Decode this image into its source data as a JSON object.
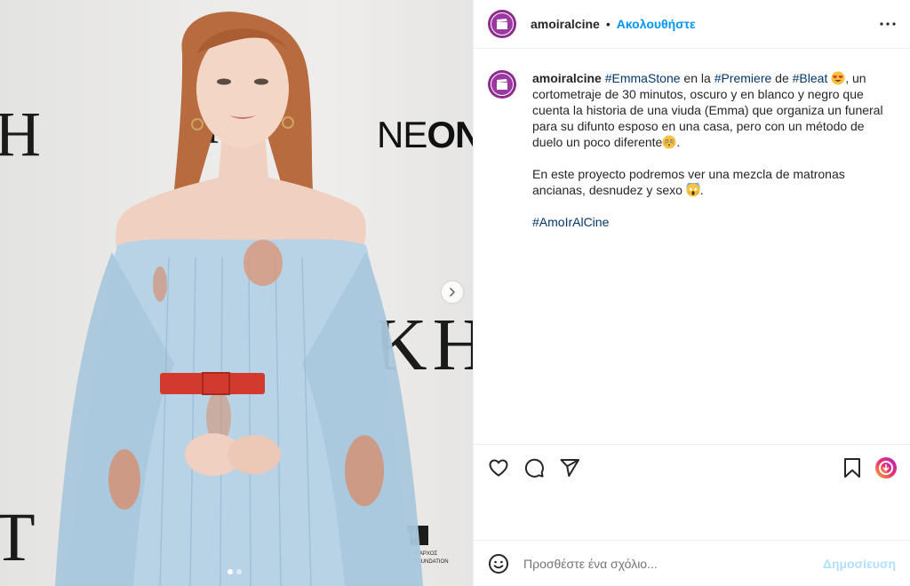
{
  "post": {
    "backdrop": {
      "neon_bold": "NE",
      "neon_rest": "ON",
      "snf_label": "N / SNF",
      "snf_caption": "Α ΣΤΑΥΡΟΣ ΝΙΑΡΧΟΣ NIARCHOS FOUNDATION",
      "letters_left": "H",
      "letters_right": "KH",
      "letters_bottom": "T"
    },
    "carousel": {
      "dot_count": 2,
      "active_index": 0
    }
  },
  "header": {
    "username": "amoiralcine",
    "separator": "•",
    "follow_label": "Ακολουθήστε"
  },
  "caption": {
    "username": "amoiralcine",
    "tag_emma": "#EmmaStone",
    "text_en_la": " en la ",
    "tag_premiere": "#Premiere",
    "text_de": " de ",
    "tag_bleat": "#Bleat",
    "text_main": ", un cortometraje de 30 minutos, oscuro y en blanco y negro que cuenta la historia de una viuda (Emma) que organiza un funeral para su difunto esposo en una casa, pero con un método de duelo un poco diferente",
    "para2": "En este proyecto podremos ver una mezcla de matronas ancianas, desnudez y sexo ",
    "para2_end": ".",
    "tag_amoir": "#AmoIrAlCine"
  },
  "actions": {
    "like": "heart-icon",
    "comment": "comment-icon",
    "share": "share-icon",
    "save": "bookmark-icon",
    "boost": "boost-icon"
  },
  "add_comment": {
    "placeholder": "Προσθέστε ένα σχόλιο...",
    "publish_label": "Δημοσίευση"
  },
  "colors": {
    "accent_blue": "#0095f6",
    "hashtag": "#00376b",
    "avatar_purple": "#8e2b8f",
    "publish_disabled": "#b2dffc"
  }
}
